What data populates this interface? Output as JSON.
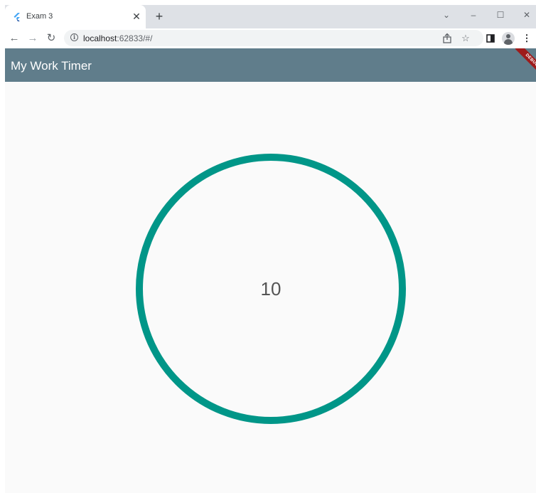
{
  "browser": {
    "tab": {
      "title": "Exam 3",
      "close": "✕",
      "favicon": "flutter-icon"
    },
    "new_tab": "+",
    "window_controls": {
      "dropdown": "⌄",
      "minimize": "–",
      "maximize": "☐",
      "close": "✕"
    },
    "toolbar": {
      "back": "←",
      "forward": "→",
      "reload": "↻",
      "url_host": "localhost",
      "url_rest": ":62833/#/"
    }
  },
  "app": {
    "title": "My Work Timer",
    "debug_label": "DEBUG",
    "colors": {
      "appbar": "#607d8b",
      "ring": "#009688"
    }
  },
  "timer": {
    "value": "10",
    "progress": 1.0
  }
}
